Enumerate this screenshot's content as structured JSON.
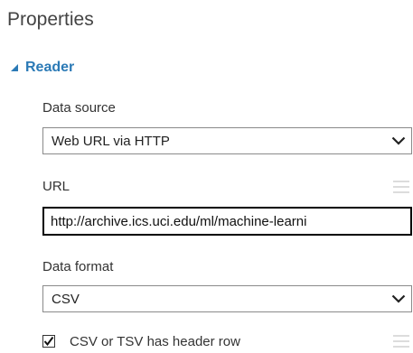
{
  "panel": {
    "title": "Properties"
  },
  "section": {
    "label": "Reader",
    "expanded": true
  },
  "fields": {
    "data_source": {
      "label": "Data source",
      "value": "Web URL via HTTP"
    },
    "url": {
      "label": "URL",
      "value": "http://archive.ics.uci.edu/ml/machine-learni"
    },
    "data_format": {
      "label": "Data format",
      "value": "CSV"
    },
    "header_row": {
      "label": "CSV or TSV has header row",
      "checked": true
    }
  },
  "colors": {
    "accent": "#2b7ab6",
    "text": "#333333",
    "border": "#8a8a8a",
    "handle": "#d0d0d0"
  },
  "icons": {
    "section_toggle": "triangle-expanded-icon",
    "dropdown": "chevron-down-icon",
    "drag": "drag-handle-icon",
    "check": "checkmark-icon"
  }
}
